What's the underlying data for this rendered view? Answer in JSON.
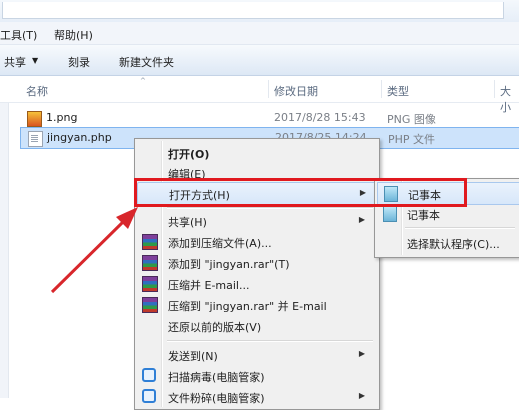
{
  "menubar": {
    "items": [
      {
        "label": "工具(T)"
      },
      {
        "label": "帮助(H)"
      }
    ]
  },
  "toolbar": {
    "share_label": "共享",
    "burn_label": "刻录",
    "new_folder_label": "新建文件夹"
  },
  "columns": {
    "name": "名称",
    "modified": "修改日期",
    "type": "类型",
    "size": "大小"
  },
  "files": [
    {
      "name": "1.png",
      "modified": "2017/8/28 15:43",
      "type": "PNG 图像",
      "icon": "png-image-icon"
    },
    {
      "name": "jingyan.php",
      "modified": "2017/8/25 14:24",
      "type": "PHP 文件",
      "icon": "php-file-icon"
    }
  ],
  "context_menu": {
    "items": [
      {
        "label": "打开(O)",
        "bold": true
      },
      {
        "label": "编辑(E)"
      },
      {
        "label": "打开方式(H)",
        "submenu": true,
        "highlighted": true
      },
      {
        "label": "共享(H)",
        "submenu": true
      },
      {
        "label": "添加到压缩文件(A)...",
        "icon": "winrar-icon"
      },
      {
        "label": "添加到 \"jingyan.rar\"(T)",
        "icon": "winrar-icon"
      },
      {
        "label": "压缩并 E-mail...",
        "icon": "winrar-icon"
      },
      {
        "label": "压缩到 \"jingyan.rar\" 并 E-mail",
        "icon": "winrar-icon"
      },
      {
        "label": "还原以前的版本(V)"
      },
      {
        "label": "发送到(N)",
        "submenu": true
      },
      {
        "label": "扫描病毒(电脑管家)",
        "icon": "shield-icon"
      },
      {
        "label": "文件粉碎(电脑管家)",
        "icon": "shield-icon",
        "submenu": true
      }
    ]
  },
  "open_with_submenu": {
    "items": [
      {
        "label": "记事本",
        "icon": "notepad-icon",
        "highlighted": true
      },
      {
        "label": "记事本",
        "icon": "notepad-icon"
      },
      {
        "label": "选择默认程序(C)..."
      }
    ]
  },
  "colors": {
    "highlight_box": "#e0191f",
    "arrow": "#d8262b",
    "selection": "#cde3fb"
  }
}
